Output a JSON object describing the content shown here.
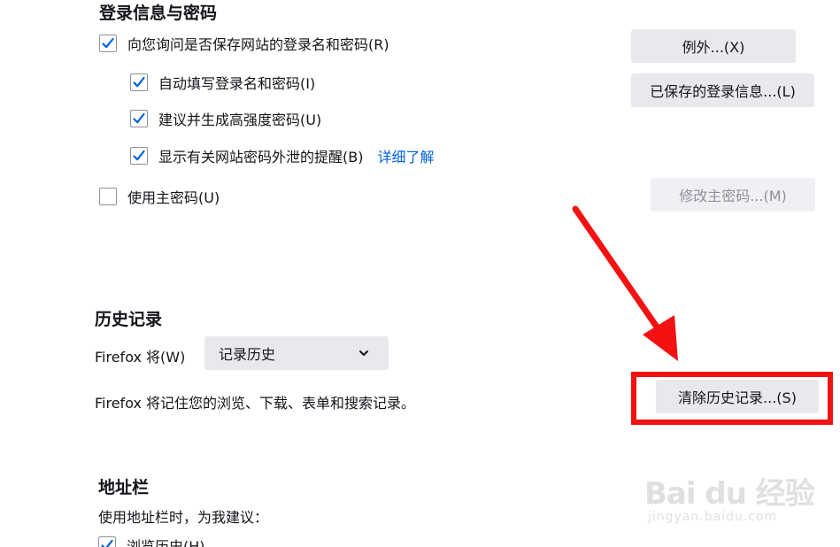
{
  "login": {
    "title": "登录信息与密码",
    "ask_save": "向您询问是否保存网站的登录名和密码(R)",
    "autofill": "自动填写登录名和密码(I)",
    "suggest": "建议并生成高强度密码(U)",
    "breach_alert": "显示有关网站密码外泄的提醒(B)",
    "learn_more": "详细了解",
    "use_master": "使用主密码(U)",
    "exceptions_btn": "例外...(X)",
    "saved_logins_btn": "已保存的登录信息...(L)",
    "change_master_btn": "修改主密码...(M)"
  },
  "history": {
    "title": "历史记录",
    "firefox_will_label": "Firefox 将(W)",
    "mode_selected": "记录历史",
    "description": "Firefox 将记住您的浏览、下载、表单和搜索记录。",
    "clear_btn": "清除历史记录...(S)"
  },
  "addressbar": {
    "title": "地址栏",
    "subtitle": "使用地址栏时，为我建议：",
    "browse_history": "浏览历史(H)"
  },
  "watermark": {
    "brand": "Bai du 经验",
    "url": "jingyan.baidu.com"
  },
  "colors": {
    "accent": "#0061e0",
    "annotation_red": "#f21212"
  },
  "icons": {
    "check": "check-icon",
    "dropdown": "chevron-down-icon",
    "annotation": "red-arrow-icon"
  }
}
